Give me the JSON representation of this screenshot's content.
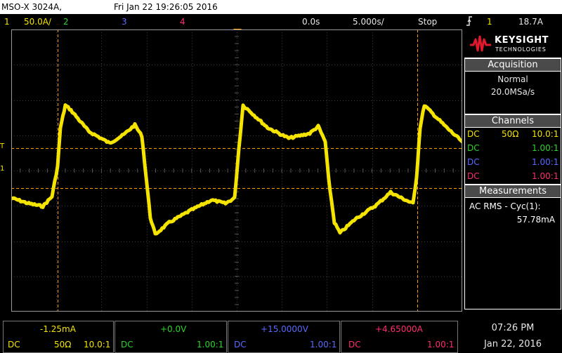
{
  "header": {
    "model": "MSO-X 3024A,",
    "datetime": "Fri Jan 22 19:26:05 2016"
  },
  "status": {
    "ch1_num": "1",
    "ch1_scale": "50.0A/",
    "ch2_num": "2",
    "ch3_num": "3",
    "ch4_num": "4",
    "time_delay": "0.0s",
    "time_scale": "5.000s/",
    "run_state": "Stop",
    "trigger_icon": "trigger-edge-icon",
    "trigger_channel": "1",
    "trigger_level": "18.7A"
  },
  "plot": {
    "trace_color": "#f5e400",
    "cursor_color": "#ff9c00",
    "trigger_level_marker": "T",
    "ch1_ground_marker": "1"
  },
  "sidebar": {
    "brand": "KEYSIGHT",
    "brand_sub": "TECHNOLOGIES",
    "brand_color": "#e3172d",
    "acquisition": {
      "title": "Acquisition",
      "mode": "Normal",
      "rate": "20.0MSa/s"
    },
    "channels": {
      "title": "Channels",
      "rows": [
        {
          "coupling": "DC",
          "impedance": "50Ω",
          "probe": "10.0:1",
          "color": "#f5e400"
        },
        {
          "coupling": "DC",
          "impedance": "",
          "probe": "1.00:1",
          "color": "#2bd32b"
        },
        {
          "coupling": "DC",
          "impedance": "",
          "probe": "1.00:1",
          "color": "#5a6aff"
        },
        {
          "coupling": "DC",
          "impedance": "",
          "probe": "1.00:1",
          "color": "#ff2c6e"
        }
      ]
    },
    "measurements": {
      "title": "Measurements",
      "label": "AC RMS - Cyc(1):",
      "value": "57.78mA"
    }
  },
  "footer": {
    "ch1": {
      "value": "-1.25mA",
      "coupling": "DC",
      "impedance": "50Ω",
      "probe": "10.0:1"
    },
    "ch2": {
      "value": "+0.0V",
      "coupling": "DC",
      "probe": "1.00:1"
    },
    "ch3": {
      "value": "+15.0000V",
      "coupling": "DC",
      "probe": "1.00:1"
    },
    "ch4": {
      "value": "+4.65000A",
      "coupling": "DC",
      "probe": "1.00:1"
    }
  },
  "clock": {
    "time": "07:26 PM",
    "date": "Jan 22, 2016"
  }
}
